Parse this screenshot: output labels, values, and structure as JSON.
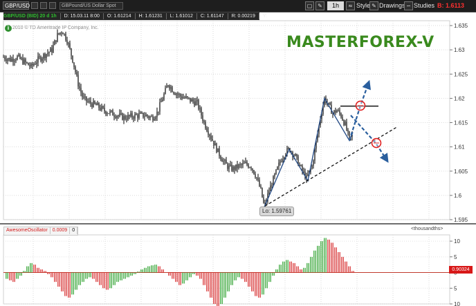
{
  "toolbar": {
    "symbol": "GBP/USD",
    "description": "GBPound/US Dollar Spot",
    "timeframe": "1h",
    "style_label": "Style",
    "drawings_label": "Drawings",
    "studies_label": "Studies",
    "bid_value": "B: 1.6113"
  },
  "info_bar": {
    "symbol_period": "GBP/USD (BID) 20 d 1h",
    "date": "D: 15.03.11 8:00",
    "open": "O: 1.61214",
    "high": "H: 1.61231",
    "low": "L: 1.61012",
    "close": "C: 1.61147",
    "range": "R: 0.00219",
    "y": "Y:"
  },
  "copyright": "2010 © TD Ameritrade IP Company, Inc.",
  "brand": "MASTERFOREX-V",
  "low_label": "Lo: 1.59761",
  "oscillator": {
    "name": "AwesomeOscillator",
    "value": "0.0009",
    "zero": "0",
    "units": "<thousandths>",
    "current_badge": "0.90324"
  },
  "colors": {
    "background": "#ffffff",
    "candle": "#000000",
    "brand": "#3a8a1e",
    "zigzag": "#2a4f88",
    "projection": "#2a5f9e",
    "osc_up": "#2ca02c",
    "osc_down": "#d62728",
    "zero_line": "#c0392b",
    "marker": "#e02020"
  },
  "chart_data": [
    {
      "type": "candlestick",
      "title": "GBP/USD (BID) 20 d 1h",
      "ylim": [
        1.595,
        1.636
      ],
      "y_ticks": [
        "1.635",
        "1.63",
        "1.625",
        "1.62",
        "1.615",
        "1.61",
        "1.605",
        "1.6",
        "1.595"
      ],
      "y_tick_values": [
        1.635,
        1.63,
        1.625,
        1.62,
        1.615,
        1.61,
        1.605,
        1.6,
        1.595
      ],
      "grid": true,
      "price_path": [
        [
          0,
          1.6285
        ],
        [
          10,
          1.628
        ],
        [
          20,
          1.6285
        ],
        [
          30,
          1.6275
        ],
        [
          40,
          1.6265
        ],
        [
          50,
          1.628
        ],
        [
          60,
          1.629
        ],
        [
          70,
          1.63
        ],
        [
          78,
          1.633
        ],
        [
          85,
          1.634
        ],
        [
          92,
          1.632
        ],
        [
          100,
          1.628
        ],
        [
          108,
          1.623
        ],
        [
          115,
          1.62
        ],
        [
          125,
          1.619
        ],
        [
          135,
          1.6185
        ],
        [
          145,
          1.6175
        ],
        [
          155,
          1.617
        ],
        [
          165,
          1.6165
        ],
        [
          175,
          1.616
        ],
        [
          185,
          1.6163
        ],
        [
          195,
          1.6165
        ],
        [
          205,
          1.6165
        ],
        [
          215,
          1.616
        ],
        [
          222,
          1.617
        ],
        [
          230,
          1.62
        ],
        [
          238,
          1.623
        ],
        [
          246,
          1.6215
        ],
        [
          255,
          1.6205
        ],
        [
          264,
          1.62
        ],
        [
          272,
          1.6195
        ],
        [
          280,
          1.619
        ],
        [
          290,
          1.615
        ],
        [
          300,
          1.612
        ],
        [
          310,
          1.609
        ],
        [
          318,
          1.607
        ],
        [
          325,
          1.6058
        ],
        [
          332,
          1.6055
        ],
        [
          340,
          1.606
        ],
        [
          350,
          1.6065
        ],
        [
          358,
          1.606
        ],
        [
          365,
          1.604
        ],
        [
          372,
          1.601
        ],
        [
          377,
          1.5976
        ],
        [
          384,
          1.601
        ],
        [
          392,
          1.604
        ],
        [
          400,
          1.607
        ],
        [
          408,
          1.609
        ],
        [
          414,
          1.6095
        ],
        [
          422,
          1.608
        ],
        [
          430,
          1.6055
        ],
        [
          438,
          1.6035
        ],
        [
          446,
          1.606
        ],
        [
          452,
          1.611
        ],
        [
          458,
          1.616
        ],
        [
          464,
          1.62
        ],
        [
          470,
          1.6185
        ],
        [
          476,
          1.617
        ],
        [
          482,
          1.6175
        ],
        [
          488,
          1.6165
        ],
        [
          494,
          1.6145
        ],
        [
          500,
          1.6115
        ],
        [
          505,
          1.6125
        ]
      ],
      "zigzag": [
        [
          377,
          1.5976
        ],
        [
          413,
          1.6095
        ],
        [
          440,
          1.603
        ],
        [
          464,
          1.62
        ],
        [
          500,
          1.6113
        ],
        [
          505,
          1.613
        ]
      ],
      "trendline": [
        [
          378,
          1.5978
        ],
        [
          570,
          1.6142
        ]
      ],
      "resistance": [
        [
          487,
          1.6184
        ],
        [
          542,
          1.6184
        ]
      ],
      "projection_up": [
        [
          500,
          1.6113
        ],
        [
          516,
          1.6185
        ],
        [
          527,
          1.6229
        ]
      ],
      "projection_down": [
        [
          502,
          1.6165
        ],
        [
          538,
          1.6108
        ],
        [
          553,
          1.6075
        ]
      ],
      "markers": [
        [
          516,
          1.6185
        ],
        [
          539,
          1.6108
        ]
      ]
    },
    {
      "type": "bar",
      "title": "AwesomeOscillator",
      "ylim": [
        -10,
        12
      ],
      "y_ticks": [
        "10",
        "5",
        "0",
        "5",
        "10"
      ],
      "y_tick_values": [
        10,
        5,
        0,
        -5,
        -10
      ],
      "values": [
        -2,
        -2.5,
        -3,
        -2,
        -1,
        0.5,
        2,
        3,
        2.5,
        1.5,
        1,
        0.5,
        -0.5,
        -1.5,
        -3,
        -4.5,
        -6,
        -7.5,
        -8,
        -7,
        -5.5,
        -4,
        -3,
        -2,
        -1.5,
        -2,
        -3,
        -4,
        -5,
        -5.5,
        -5,
        -4,
        -3,
        -2.5,
        -2,
        -1.5,
        -1,
        -0.5,
        0.3,
        1,
        1.5,
        2,
        2.3,
        2.5,
        2,
        1,
        0,
        -1,
        -2,
        -3,
        -4,
        -3.5,
        -2.5,
        -1.5,
        -0.5,
        -1,
        -2,
        -4,
        -6,
        -8,
        -10,
        -11,
        -10,
        -8,
        -6,
        -4,
        -2.5,
        -1.5,
        -2,
        -3,
        -4.5,
        -6,
        -7.5,
        -8,
        -7,
        -5,
        -3,
        -1,
        1,
        2.5,
        3.5,
        4,
        3.5,
        3,
        2,
        1,
        1.5,
        3,
        5,
        7,
        8.5,
        10,
        11,
        10.5,
        9.5,
        8,
        6.5,
        5,
        3.5,
        2,
        0.5
      ]
    }
  ]
}
